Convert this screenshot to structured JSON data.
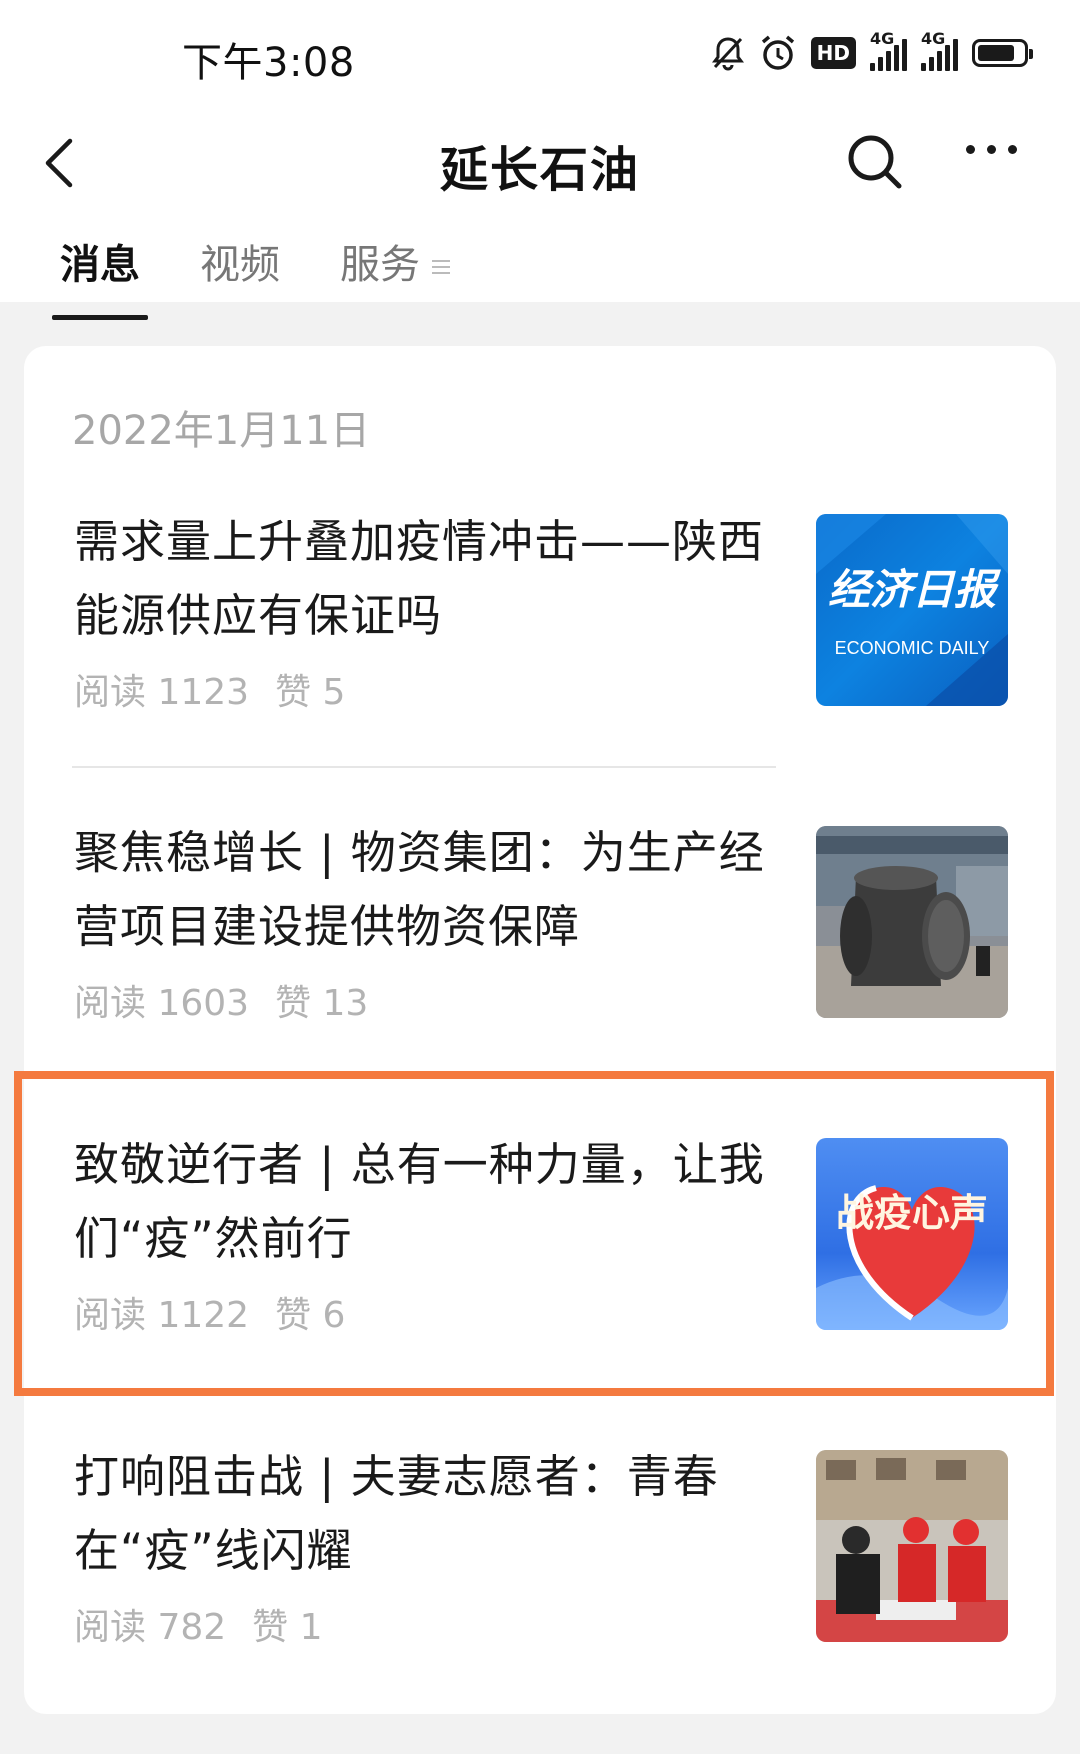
{
  "status_bar": {
    "time": "下午3:08",
    "hd_label": "HD",
    "network_1": "4G",
    "network_2": "4G"
  },
  "nav": {
    "title": "延长石油",
    "back_icon": "back-arrow-icon",
    "search_icon": "search-icon",
    "more_icon": "more-dots-icon"
  },
  "tabs": [
    {
      "label": "消息",
      "active": true
    },
    {
      "label": "视频",
      "active": false
    },
    {
      "label": "服务",
      "active": false
    }
  ],
  "feed": {
    "date": "2022年1月11日",
    "articles": [
      {
        "title": "需求量上升叠加疫情冲击——陕西能源供应有保证吗",
        "reads": "阅读 1123",
        "likes": "赞 5",
        "thumb_title": "经济日报",
        "thumb_subtitle": "ECONOMIC DAILY"
      },
      {
        "title": "聚焦稳增长 | 物资集团：为生产经营项目建设提供物资保障",
        "reads": "阅读 1603",
        "likes": "赞 13"
      },
      {
        "title": "致敬逆行者 | 总有一种力量，让我们“疫”然前行",
        "reads": "阅读 1122",
        "likes": "赞 6",
        "thumb_title": "战疫心声"
      },
      {
        "title": "打响阻击战 | 夫妻志愿者：青春在“疫”线闪耀",
        "reads": "阅读 782",
        "likes": "赞 1"
      }
    ]
  },
  "colors": {
    "highlight": "#f47a3f",
    "background": "#f2f2f2"
  }
}
